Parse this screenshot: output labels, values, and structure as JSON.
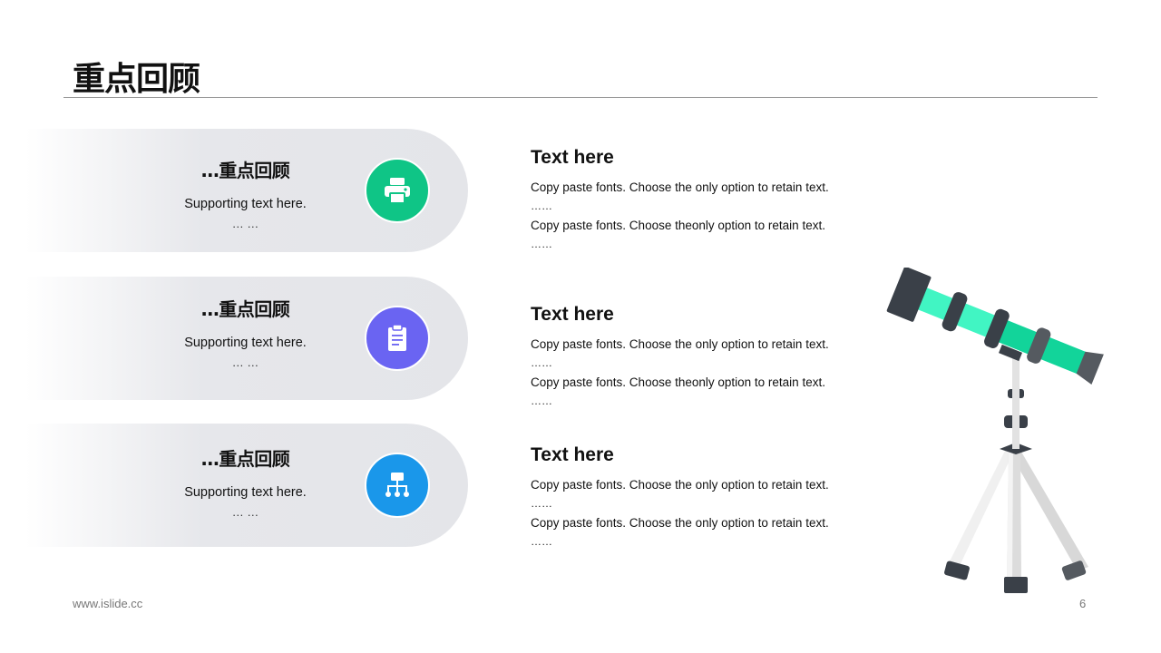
{
  "page": {
    "title": "重点回顾"
  },
  "items": [
    {
      "heading": "…重点回顾",
      "sub": "Supporting  text here.",
      "dots": "… …",
      "icon": "printer-icon",
      "color": "#0fc586"
    },
    {
      "heading": "…重点回顾",
      "sub": "Supporting  text here.",
      "dots": "… …",
      "icon": "clipboard-icon",
      "color": "#6a64f2"
    },
    {
      "heading": "…重点回顾",
      "sub": "Supporting  text here.",
      "dots": "… …",
      "icon": "org-chart-icon",
      "color": "#1a97ea"
    }
  ],
  "blocks": [
    {
      "title": "Text here",
      "line1": "Copy paste fonts. Choose the only option to retain text.",
      "dots1": "……",
      "line2": "Copy paste fonts. Choose theonly option to retain text.",
      "dots2": "……"
    },
    {
      "title": "Text here",
      "line1": "Copy paste fonts. Choose the only option to retain text.",
      "dots1": "……",
      "line2": "Copy paste fonts. Choose theonly option to retain text.",
      "dots2": "……"
    },
    {
      "title": "Text here",
      "line1": "Copy paste fonts. Choose the only option to retain text.",
      "dots1": "……",
      "line2": "Copy paste fonts. Choose the only option to retain text.",
      "dots2": "……"
    }
  ],
  "footer": {
    "site": "www.islide.cc",
    "page_number": "6"
  },
  "illustration": {
    "icon": "telescope-icon",
    "accent": "#41f5c3",
    "dark": "#3a4048"
  }
}
